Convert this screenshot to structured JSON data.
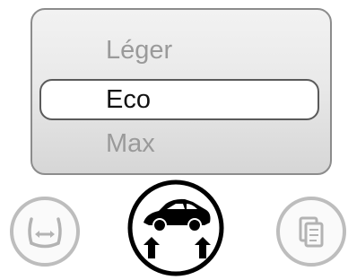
{
  "mode_menu": {
    "options": [
      "Léger",
      "Eco",
      "Max"
    ],
    "selected": "Eco"
  },
  "controls": {
    "left_icon": "tire-pressure-icon",
    "center_icon": "car-lift-icon",
    "right_icon": "copy-pages-icon"
  }
}
